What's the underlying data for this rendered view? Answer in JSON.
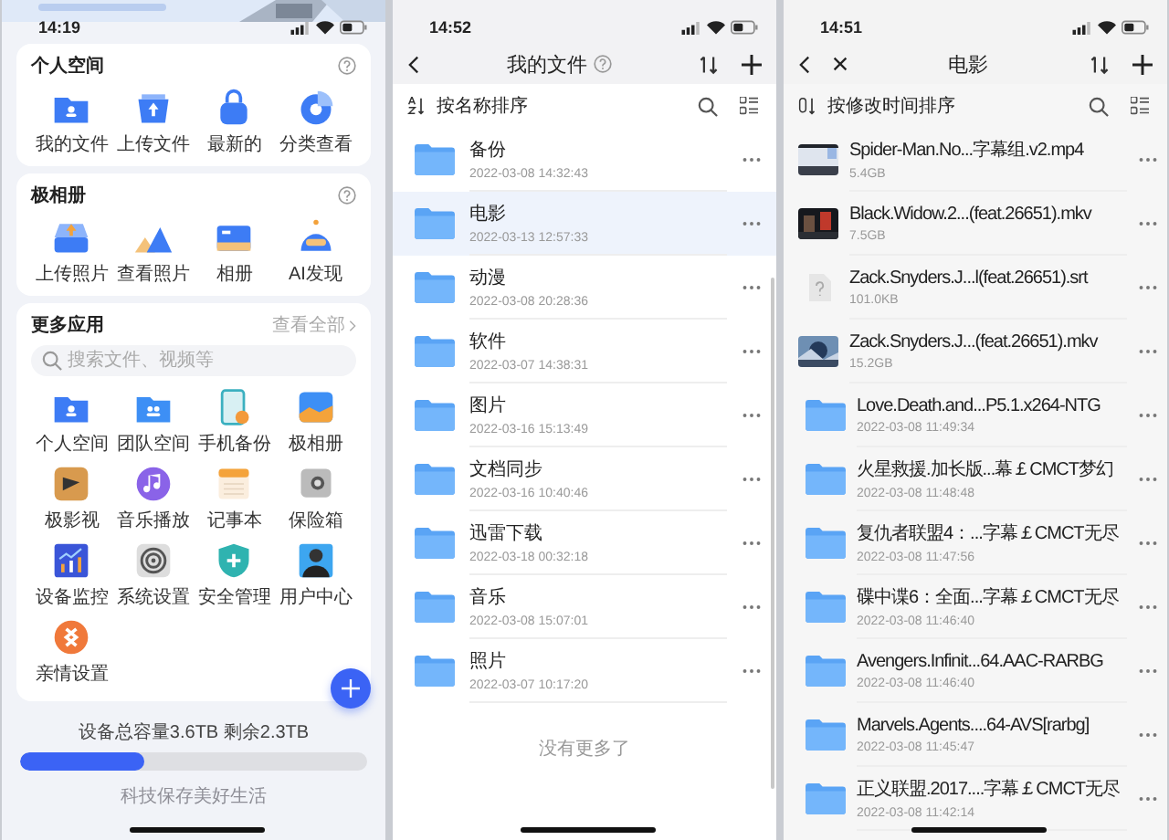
{
  "home": {
    "status_time": "14:19",
    "sections": [
      {
        "title": "个人空间",
        "items": [
          "我的文件",
          "上传文件",
          "最新的",
          "分类查看"
        ]
      },
      {
        "title": "极相册",
        "items": [
          "上传照片",
          "查看照片",
          "相册",
          "AI发现"
        ]
      }
    ],
    "apps": {
      "title": "更多应用",
      "link": "查看全部",
      "search_placeholder": "搜索文件、视频等",
      "items": [
        "个人空间",
        "团队空间",
        "手机备份",
        "极相册",
        "极影视",
        "音乐播放",
        "记事本",
        "保险箱",
        "设备监控",
        "系统设置",
        "安全管理",
        "用户中心",
        "亲情设置"
      ]
    },
    "storage": {
      "text": "设备总容量3.6TB 剩余2.3TB",
      "level": 0.36
    },
    "slogan": "科技保存美好生活"
  },
  "my_files": {
    "status_time": "14:52",
    "title": "我的文件",
    "sort_label": "按名称排序",
    "rows": [
      {
        "name": "备份",
        "date": "2022-03-08 14:32:43",
        "selected": false
      },
      {
        "name": "电影",
        "date": "2022-03-13 12:57:33",
        "selected": true
      },
      {
        "name": "动漫",
        "date": "2022-03-08 20:28:36",
        "selected": false
      },
      {
        "name": "软件",
        "date": "2022-03-07 14:38:31",
        "selected": false
      },
      {
        "name": "图片",
        "date": "2022-03-16 15:13:49",
        "selected": false
      },
      {
        "name": "文档同步",
        "date": "2022-03-16 10:40:46",
        "selected": false
      },
      {
        "name": "迅雷下载",
        "date": "2022-03-18 00:32:18",
        "selected": false
      },
      {
        "name": "音乐",
        "date": "2022-03-08 15:07:01",
        "selected": false
      },
      {
        "name": "照片",
        "date": "2022-03-07 10:17:20",
        "selected": false
      }
    ],
    "end_text": "没有更多了"
  },
  "movies": {
    "status_time": "14:51",
    "title": "电影",
    "sort_label": "按修改时间排序",
    "rows": [
      {
        "kind": "video",
        "name": "Spider-Man.No...字幕组.v2.mp4",
        "meta": "5.4GB"
      },
      {
        "kind": "video",
        "name": "Black.Widow.2...(feat.26651).mkv",
        "meta": "7.5GB"
      },
      {
        "kind": "file",
        "name": "Zack.Snyders.J...l(feat.26651).srt",
        "meta": "101.0KB"
      },
      {
        "kind": "video",
        "name": "Zack.Snyders.J...(feat.26651).mkv",
        "meta": "15.2GB"
      },
      {
        "kind": "folder",
        "name": "Love.Death.and...P5.1.x264-NTG",
        "meta": "2022-03-08 11:49:34"
      },
      {
        "kind": "folder",
        "name": "火星救援.加长版...幕￡CMCT梦幻",
        "meta": "2022-03-08 11:48:48"
      },
      {
        "kind": "folder",
        "name": "复仇者联盟4：...字幕￡CMCT无尽",
        "meta": "2022-03-08 11:47:56"
      },
      {
        "kind": "folder",
        "name": "碟中谍6：全面...字幕￡CMCT无尽",
        "meta": "2022-03-08 11:46:40"
      },
      {
        "kind": "folder",
        "name": "Avengers.Infinit...64.AAC-RARBG",
        "meta": "2022-03-08 11:46:40"
      },
      {
        "kind": "folder",
        "name": "Marvels.Agents....64-AVS[rarbg]",
        "meta": "2022-03-08 11:45:47"
      },
      {
        "kind": "folder",
        "name": "正义联盟.2017....字幕￡CMCT无尽",
        "meta": "2022-03-08 11:42:14"
      }
    ]
  }
}
